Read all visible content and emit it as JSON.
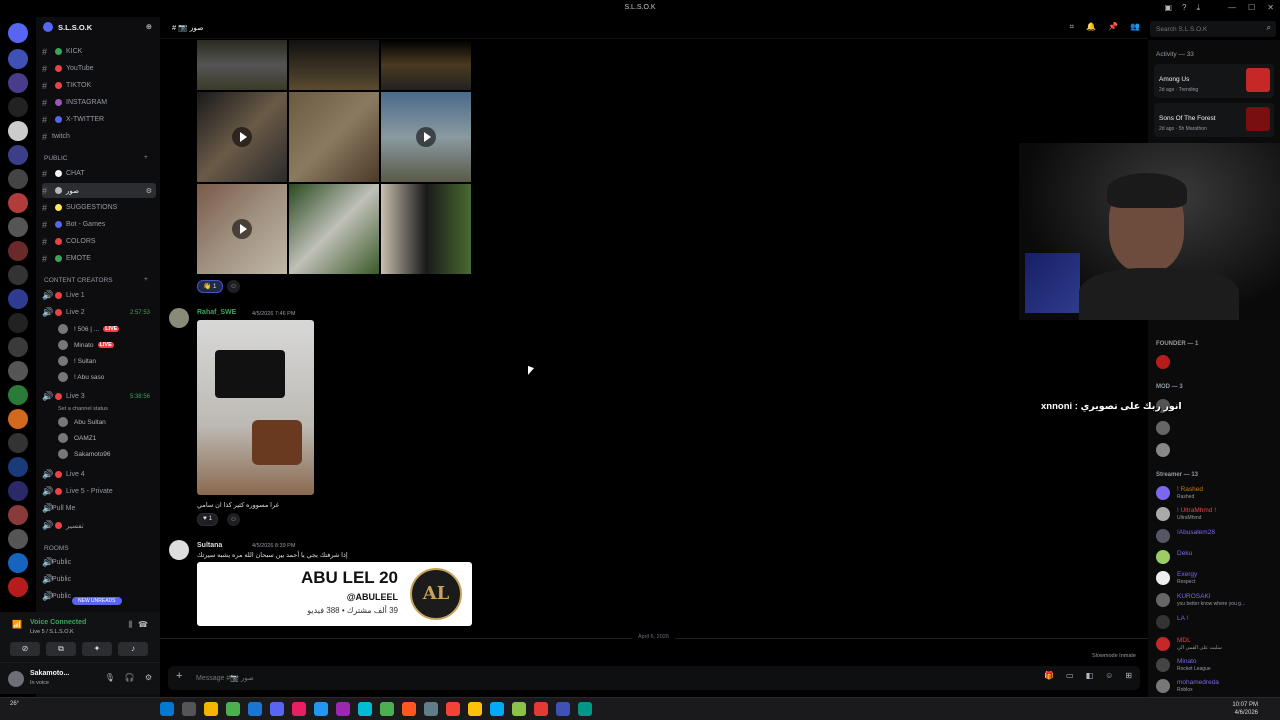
{
  "window": {
    "title": "S.L.S.O.K",
    "controls": [
      "—",
      "☐",
      "✕"
    ]
  },
  "server": {
    "name": "S.L.S.O.K",
    "channels_top": [
      {
        "label": "KICK",
        "color": "#3ba55c"
      },
      {
        "label": "YouTube",
        "color": "#ed4245"
      },
      {
        "label": "TIKTOK",
        "color": "#ed4245"
      },
      {
        "label": "INSTAGRAM",
        "color": "#9b59b6"
      },
      {
        "label": "X-TWITTER",
        "color": "#5865f2"
      },
      {
        "label": "twitch",
        "color": "#9146ff"
      }
    ],
    "public_category": "PUBLIC",
    "public_channels": [
      {
        "label": "CHAT",
        "color": "#f2f3f5"
      },
      {
        "label": "صور",
        "color": "#f2f3f5"
      },
      {
        "label": "SUGGESTIONS",
        "color": "#fee75c"
      },
      {
        "label": "Bot - Games",
        "color": "#5865f2"
      },
      {
        "label": "COLORS",
        "color": "#ed4245"
      },
      {
        "label": "EMOTE",
        "color": "#3ba55c"
      }
    ],
    "creators_category": "CONTENT CREATORS",
    "voice": [
      {
        "label": "Live 1"
      },
      {
        "label": "Live 2",
        "timer": "2:57:53"
      },
      {
        "label": "Live 3",
        "timer": "5:38:56",
        "status": "Set a channel status"
      },
      {
        "label": "Live 4"
      },
      {
        "label": "Live 5 - Private"
      },
      {
        "label": "Pull Me"
      },
      {
        "label": "تفسير"
      }
    ],
    "live2_users": [
      {
        "name": "! 506 | ...",
        "live": "LIVE"
      },
      {
        "name": "Minato",
        "live": "LIVE"
      },
      {
        "name": "! Sultan"
      },
      {
        "name": "! Abu saso"
      }
    ],
    "live3_users": [
      {
        "name": "Abu Sultan"
      },
      {
        "name": "OAMZ1"
      },
      {
        "name": "Sakamoto96"
      }
    ],
    "rooms_category": "ROOMS",
    "rooms": [
      "Public",
      "Public",
      "Public"
    ],
    "new_unreads": "NEW UNREADS"
  },
  "voice_connected": {
    "title": "Voice Connected",
    "sub": "Live 5 / S.L.S.O.K"
  },
  "user": {
    "name": "Sakamoto...",
    "status": "In voice"
  },
  "channel_header": {
    "name": "صور"
  },
  "messages": [
    {
      "author": "Rahaf_SWE",
      "timestamp": "4/5/2026 7:46 PM",
      "text": "غرا مسووره كثير كذا ان سامي",
      "reaction": "1"
    },
    {
      "author": "Sultana",
      "timestamp": "4/5/2026 8:39 PM",
      "text": "إذا شرفتك يجي يا أحمد بين سبحان الله مره يشبه سيرتك"
    }
  ],
  "first_reaction": {
    "emoji": "👋",
    "count": "1"
  },
  "embed": {
    "title": "ABU LEL 20",
    "handle": "@ABULEEL",
    "stats": "39 ألف مشترك • 388 فيديو",
    "logo": "AL"
  },
  "date_separator": "April 6, 2026",
  "slowmode": "Slowmode Inmate",
  "composer": {
    "placeholder": "Message #📷 صور"
  },
  "search": {
    "placeholder": "Search S.L.S.O.K"
  },
  "activity": {
    "header": "Activity — 33",
    "items": [
      {
        "name": "Among Us",
        "meta": "2d ago · Trending"
      },
      {
        "name": "Sons Of The Forest",
        "meta": "2d ago · 5h Marathon"
      }
    ]
  },
  "member_list": {
    "founder_role": "FOUNDER — 1",
    "mod_role": "MOD — 3",
    "streamer_role": "Streamer — 13",
    "streamers": [
      {
        "name": "! Rashed",
        "sub": "Rashed",
        "color": "#c27c0e"
      },
      {
        "name": "! UltraMhmd !",
        "sub": "UltraMhmd",
        "color": "#ed4245"
      },
      {
        "name": "!Abusalem28",
        "sub": "",
        "color": "#7b68ee"
      },
      {
        "name": "Deku",
        "sub": "",
        "color": "#7b68ee"
      },
      {
        "name": "Exergy",
        "sub": "Respect",
        "color": "#7b68ee"
      },
      {
        "name": "KUROSAKI",
        "sub": "you better know where you g...",
        "color": "#7b68ee"
      },
      {
        "name": "LA !",
        "sub": "",
        "color": "#7b68ee"
      },
      {
        "name": "MDL",
        "sub": "سلبت على القمي الي",
        "color": "#ed4245"
      },
      {
        "name": "Minato",
        "sub": "Rocket League",
        "color": "#7b68ee"
      },
      {
        "name": "mohamedreda",
        "sub": "Roblox",
        "color": "#7b68ee"
      }
    ]
  },
  "overlay_text": "xnnoni : انور ربك على تصويري",
  "taskbar": {
    "weather": "26°",
    "time": "10:07 PM",
    "date": "4/6/2026"
  }
}
